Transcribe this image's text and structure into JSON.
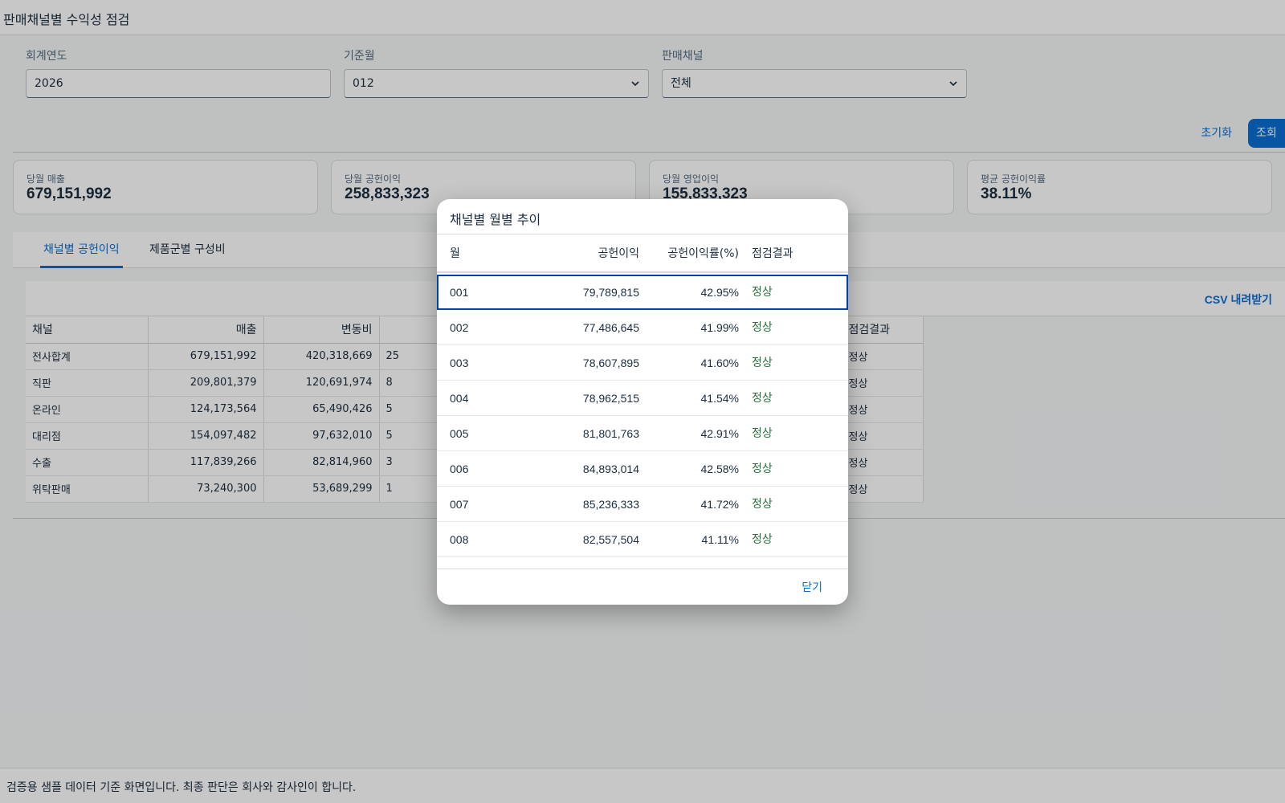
{
  "shell": {
    "title": "판매채널별 수익성 점검"
  },
  "filters": {
    "fiscal_year": {
      "label": "회계연도",
      "value": "2026"
    },
    "period": {
      "label": "기준월",
      "value": "012"
    },
    "channel": {
      "label": "판매채널",
      "value": "전체"
    },
    "reset_label": "초기화",
    "go_label": "조회"
  },
  "kpis": [
    {
      "label": "당월 매출",
      "value": "679,151,992"
    },
    {
      "label": "당월 공헌이익",
      "value": "258,833,323"
    },
    {
      "label": "당월 영업이익",
      "value": "155,833,323"
    },
    {
      "label": "평균 공헌이익률",
      "value": "38.11%"
    }
  ],
  "tabs": [
    {
      "label": "채널별 공헌이익",
      "active": true
    },
    {
      "label": "제품군별 구성비",
      "active": false
    }
  ],
  "table": {
    "csv_label": "CSV 내려받기",
    "columns": [
      "채널",
      "매출",
      "변동비",
      "",
      "",
      "",
      "",
      "점검결과"
    ],
    "rows": [
      {
        "channel": "전사합계",
        "sales": "679,151,992",
        "variable_cost": "420,318,669",
        "partial": "25",
        "status": "정상"
      },
      {
        "channel": "직판",
        "sales": "209,801,379",
        "variable_cost": "120,691,974",
        "partial": "8",
        "status": "정상"
      },
      {
        "channel": "온라인",
        "sales": "124,173,564",
        "variable_cost": "65,490,426",
        "partial": "5",
        "status": "정상"
      },
      {
        "channel": "대리점",
        "sales": "154,097,482",
        "variable_cost": "97,632,010",
        "partial": "5",
        "status": "정상"
      },
      {
        "channel": "수출",
        "sales": "117,839,266",
        "variable_cost": "82,814,960",
        "partial": "3",
        "status": "정상"
      },
      {
        "channel": "위탁판매",
        "sales": "73,240,300",
        "variable_cost": "53,689,299",
        "partial": "1",
        "status": "정상"
      }
    ]
  },
  "dialog": {
    "title": "채널별 월별 추이",
    "columns": {
      "month": "월",
      "profit": "공헌이익",
      "rate": "공헌이익률(%)",
      "status": "점검결과"
    },
    "rows": [
      {
        "month": "001",
        "profit": "79,789,815",
        "rate": "42.95%",
        "status": "정상"
      },
      {
        "month": "002",
        "profit": "77,486,645",
        "rate": "41.99%",
        "status": "정상"
      },
      {
        "month": "003",
        "profit": "78,607,895",
        "rate": "41.60%",
        "status": "정상"
      },
      {
        "month": "004",
        "profit": "78,962,515",
        "rate": "41.54%",
        "status": "정상"
      },
      {
        "month": "005",
        "profit": "81,801,763",
        "rate": "42.91%",
        "status": "정상"
      },
      {
        "month": "006",
        "profit": "84,893,014",
        "rate": "42.58%",
        "status": "정상"
      },
      {
        "month": "007",
        "profit": "85,236,333",
        "rate": "41.72%",
        "status": "정상"
      },
      {
        "month": "008",
        "profit": "82,557,504",
        "rate": "41.11%",
        "status": "정상"
      }
    ],
    "close_label": "닫기"
  },
  "footer": {
    "text": "검증용 샘플 데이터 기준 화면입니다. 최종 판단은 회사와 감사인이 합니다."
  }
}
